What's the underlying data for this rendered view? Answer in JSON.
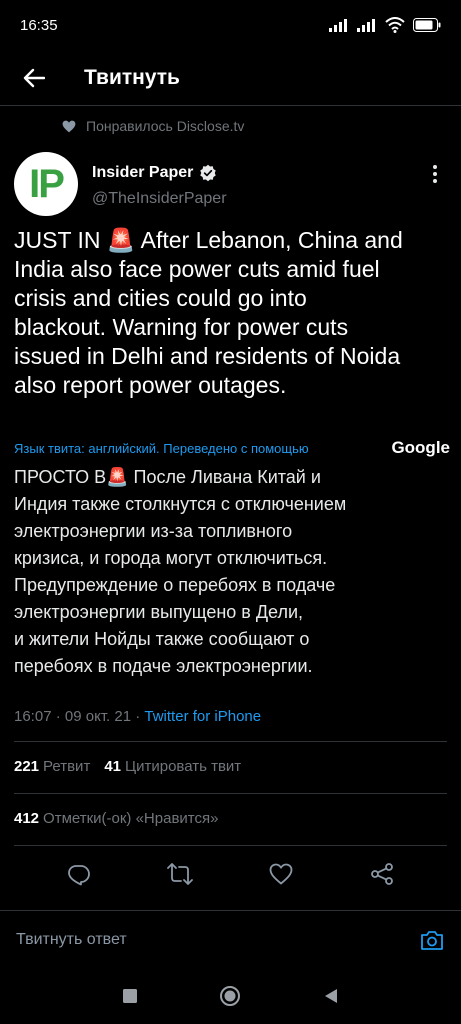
{
  "status_bar": {
    "time": "16:35",
    "battery_level": 0.85
  },
  "header": {
    "title": "Твитнуть"
  },
  "liked_by": {
    "text": "Понравилось Disclose.tv"
  },
  "author": {
    "avatar_text": "IP",
    "name": "Insider Paper",
    "handle": "@TheInsiderPaper",
    "verified": true
  },
  "tweet": {
    "lines": [
      "JUST IN 🚨 After Lebanon, China and",
      "India also face power cuts amid fuel",
      "crisis and cities could go into",
      "blackout. Warning for power cuts",
      "issued in Delhi and residents of Noida",
      "also report power outages."
    ]
  },
  "translation": {
    "label": "Язык твита: английский. Переведено с помощью",
    "provider": "Google",
    "lines": [
      "ПРОСТО В🚨 После Ливана Китай и",
      "Индия также столкнутся с отключением",
      "электроэнергии из-за топливного",
      "кризиса, и города могут отключиться.",
      "Предупреждение о перебоях в подаче",
      "электроэнергии выпущено в Дели,",
      "и жители Нойды также сообщают о",
      "перебоях в подаче электроэнергии."
    ]
  },
  "meta": {
    "time": "16:07",
    "date": "09 окт. 21",
    "separator": "·",
    "source": "Twitter for iPhone"
  },
  "stats": {
    "retweets": "221",
    "retweets_label": "Ретвит",
    "quotes": "41",
    "quotes_label": "Цитировать твит",
    "likes": "412",
    "likes_label": "Отметки(-ок) «Нравится»"
  },
  "reply": {
    "placeholder": "Твитнуть ответ"
  },
  "icons": {
    "back": "arrow-left-icon",
    "more": "more-vertical-icon",
    "verified": "verified-badge-icon",
    "heart": "heart-icon",
    "reply": "reply-icon",
    "retweet": "retweet-icon",
    "like": "like-icon",
    "share": "share-icon",
    "camera": "camera-icon"
  },
  "colors": {
    "accent": "#1d9bf0",
    "background": "#000000",
    "muted": "#71767b",
    "avatar_brand": "#3aa142"
  }
}
